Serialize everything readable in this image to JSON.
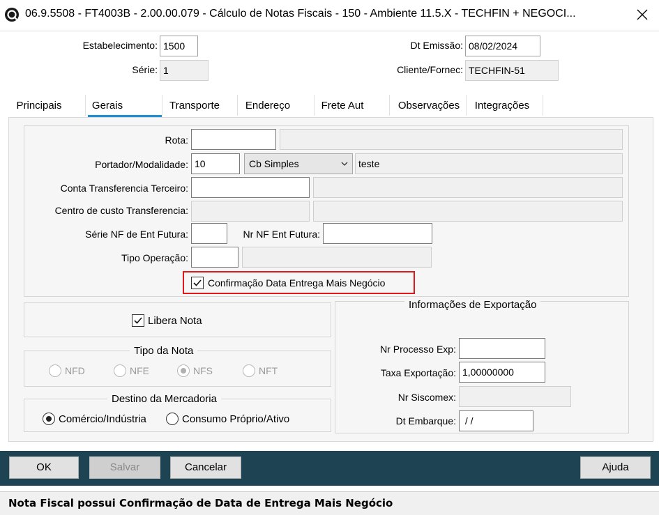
{
  "window": {
    "title": "06.9.5508 - FT4003B - 2.00.00.079 - Cálculo de Notas Fiscais - 150 - Ambiente 11.5.X - TECHFIN + NEGOCI...",
    "close_icon": "close-icon"
  },
  "header": {
    "estabelecimento_label": "Estabelecimento:",
    "estabelecimento_value": "1500",
    "serie_label": "Série:",
    "serie_value": "1",
    "dt_emissao_label": "Dt Emissão:",
    "dt_emissao_value": "08/02/2024",
    "cliente_label": "Cliente/Fornec:",
    "cliente_value": "TECHFIN-51"
  },
  "tabs": [
    {
      "label": "Principais"
    },
    {
      "label": "Gerais",
      "active": true
    },
    {
      "label": "Transporte"
    },
    {
      "label": "Endereço"
    },
    {
      "label": "Frete Aut"
    },
    {
      "label": "Observações"
    },
    {
      "label": "Integrações"
    }
  ],
  "gerais": {
    "rota_label": "Rota:",
    "rota_value": "",
    "rota_desc": "",
    "portador_label": "Portador/Modalidade:",
    "portador_value": "10",
    "modalidade_selected": "Cb Simples",
    "portador_desc": "teste",
    "conta_label": "Conta Transferencia Terceiro:",
    "conta_value": "",
    "centro_label": "Centro de custo Transferencia:",
    "serie_nf_label": "Série NF de Ent Futura:",
    "serie_nf_value": "",
    "nr_nf_label": "Nr NF Ent Futura:",
    "nr_nf_value": "",
    "tipo_operacao_label": "Tipo Operação:",
    "tipo_operacao_value": "",
    "confirmacao_label": "Confirmação Data Entrega Mais Negócio",
    "confirmacao_checked": true,
    "libera_nota_label": "Libera Nota",
    "libera_nota_checked": true
  },
  "tipo_nota": {
    "title": "Tipo da Nota",
    "options": [
      "NFD",
      "NFE",
      "NFS",
      "NFT"
    ],
    "selected": "NFS",
    "disabled": true
  },
  "destino": {
    "title": "Destino da Mercadoria",
    "options": [
      "Comércio/Indústria",
      "Consumo Próprio/Ativo"
    ],
    "selected": "Comércio/Indústria"
  },
  "exportacao": {
    "title": "Informações de Exportação",
    "nr_processo_label": "Nr Processo Exp:",
    "nr_processo_value": "",
    "taxa_label": "Taxa Exportação:",
    "taxa_value": "1,00000000",
    "siscomex_label": "Nr Siscomex:",
    "siscomex_value": "",
    "dt_embarque_label": "Dt Embarque:",
    "dt_embarque_value": " / /"
  },
  "buttons": {
    "ok": "OK",
    "salvar": "Salvar",
    "cancelar": "Cancelar",
    "ajuda": "Ajuda"
  },
  "status": {
    "message": "Nota Fiscal possui Confirmação de Data de Entrega Mais Negócio"
  },
  "colors": {
    "accent_tab": "#1e90d8",
    "button_bar": "#1e4454",
    "highlight": "#e0181b"
  }
}
